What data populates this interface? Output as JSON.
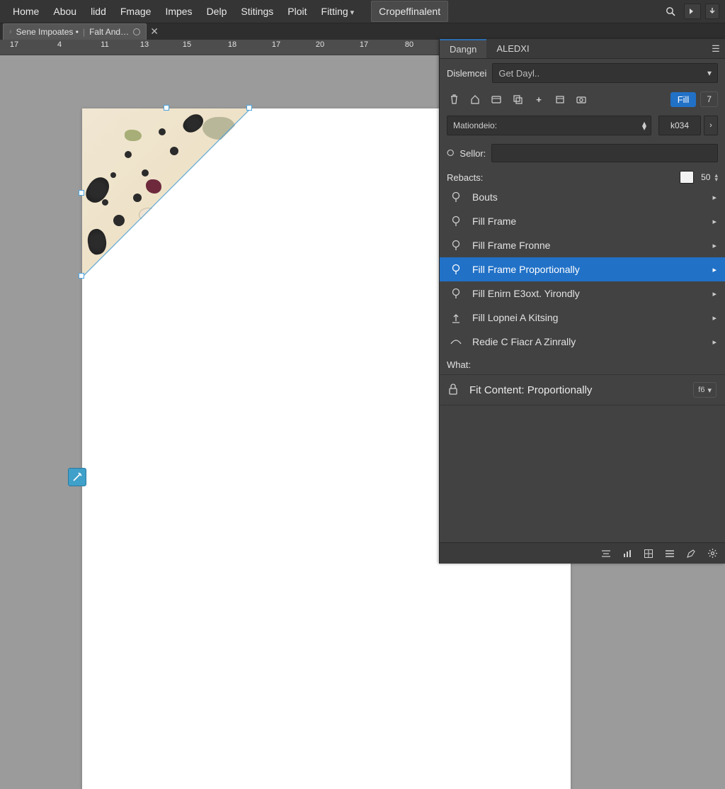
{
  "menu": {
    "items": [
      "Home",
      "Abou",
      "lidd",
      "Fmage",
      "Impes",
      "Delp",
      "Stitings",
      "Ploit",
      "Fitting"
    ],
    "mode_button": "Cropeffinalent"
  },
  "doc_tab": {
    "name_left": "Sene Impoates •",
    "name_right": "Falt And…"
  },
  "ruler": {
    "labels": [
      "17",
      "4",
      "11",
      "13",
      "15",
      "18",
      "17",
      "20",
      "17",
      "80"
    ]
  },
  "panel": {
    "tabs": [
      "Dangn",
      "ALEDXI"
    ],
    "field1_label": "Dislemcei",
    "field1_value": "Get Dayl..",
    "fill_label": "Fill",
    "fill_num": "7",
    "combo_value": "Mationdeio:",
    "num_value": "k034",
    "search_label": "Sellor:",
    "rebacts_label": "Rebacts:",
    "rebacts_num": "50",
    "actions": [
      {
        "label": "Bouts"
      },
      {
        "label": "Fill Frame"
      },
      {
        "label": "Fill Frame Fronne"
      },
      {
        "label": "Fill Frame Proportionally",
        "selected": true
      },
      {
        "label": "Fill Enirn E3oxt. Yirondly"
      },
      {
        "label": "Fill Lopnei A Kitsing"
      },
      {
        "label": "Redie C Fiacr A Zinrally"
      }
    ],
    "what_label": "What:",
    "applied_label": "Fit Content: Proportionally",
    "applied_chip": "f6"
  }
}
